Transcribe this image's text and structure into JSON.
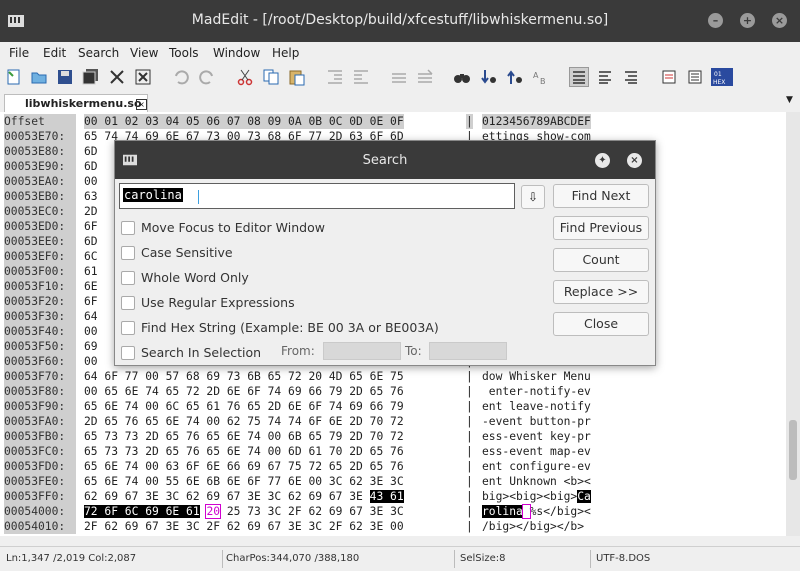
{
  "window": {
    "title": "MadEdit - [/root/Desktop/build/xfcestuff/libwhiskermenu.so]"
  },
  "menu": [
    "File",
    "Edit",
    "Search",
    "View",
    "Tools",
    "Window",
    "Help"
  ],
  "tab": {
    "label": "libwhiskermenu.so"
  },
  "hex": {
    "header": {
      "offset": "Offset",
      "hex": "00 01 02 03 04 05 06 07 08 09 0A 0B 0C 0D 0E 0F",
      "ascii": "0123456789ABCDEF"
    },
    "rows": [
      {
        "offset": "00053E70:",
        "hex": "65 74 74 69 6E 67 73 00 73 68 6F 77 2D 63 6F 6D",
        "ascii": "ettings show-com"
      },
      {
        "offset": "00053E80:",
        "hex": "6D",
        "ascii": ""
      },
      {
        "offset": "00053E90:",
        "hex": "6D",
        "ascii": ""
      },
      {
        "offset": "00053EA0:",
        "hex": "00",
        "ascii": ""
      },
      {
        "offset": "00053EB0:",
        "hex": "63",
        "ascii": ""
      },
      {
        "offset": "00053EC0:",
        "hex": "2D",
        "ascii": ""
      },
      {
        "offset": "00053ED0:",
        "hex": "6F",
        "ascii": ""
      },
      {
        "offset": "00053EE0:",
        "hex": "6D",
        "ascii": ""
      },
      {
        "offset": "00053EF0:",
        "hex": "6C",
        "ascii": ""
      },
      {
        "offset": "00053F00:",
        "hex": "61",
        "ascii": ""
      },
      {
        "offset": "00053F10:",
        "hex": "6E",
        "ascii": ""
      },
      {
        "offset": "00053F20:",
        "hex": "6F",
        "ascii": ""
      },
      {
        "offset": "00053F30:",
        "hex": "64",
        "ascii": ""
      },
      {
        "offset": "00053F40:",
        "hex": "00",
        "ascii": ""
      },
      {
        "offset": "00053F50:",
        "hex": "69",
        "ascii": ""
      },
      {
        "offset": "00053F60:",
        "hex": "00",
        "ascii": ""
      },
      {
        "offset": "00053F70:",
        "hex": "64 6F 77 00 57 68 69 73 6B 65 72 20 4D 65 6E 75",
        "ascii": "dow Whisker Menu"
      },
      {
        "offset": "00053F80:",
        "hex": "00 65 6E 74 65 72 2D 6E 6F 74 69 66 79 2D 65 76",
        "ascii": " enter-notify-ev"
      },
      {
        "offset": "00053F90:",
        "hex": "65 6E 74 00 6C 65 61 76 65 2D 6E 6F 74 69 66 79",
        "ascii": "ent leave-notify"
      },
      {
        "offset": "00053FA0:",
        "hex": "2D 65 76 65 6E 74 00 62 75 74 74 6F 6E 2D 70 72",
        "ascii": "-event button-pr"
      },
      {
        "offset": "00053FB0:",
        "hex": "65 73 73 2D 65 76 65 6E 74 00 6B 65 79 2D 70 72",
        "ascii": "ess-event key-pr"
      },
      {
        "offset": "00053FC0:",
        "hex": "65 73 73 2D 65 76 65 6E 74 00 6D 61 70 2D 65 76",
        "ascii": "ess-event map-ev"
      },
      {
        "offset": "00053FD0:",
        "hex": "65 6E 74 00 63 6F 6E 66 69 67 75 72 65 2D 65 76",
        "ascii": "ent configure-ev"
      },
      {
        "offset": "00053FE0:",
        "hex": "65 6E 74 00 55 6E 6B 6E 6F 77 6E 00 3C 62 3E 3C",
        "ascii": "ent Unknown <b><"
      },
      {
        "offset": "00053FF0:",
        "hex": "62 69 67 3E 3C 62 69 67 3E 3C 62 69 67 3E ",
        "hexsel": "43 61",
        "ascii": "big><big><big>",
        "asciisel": "Ca"
      },
      {
        "offset": "00054000:",
        "hexselpre": "72 6F 6C 69 6E 61",
        "hexcaret": "20",
        "hex": " 25 73 3C 2F 62 69 67 3E 3C",
        "asciiselpre": "rolina",
        "asciicaret": " ",
        "ascii": "%s</big><"
      },
      {
        "offset": "00054010:",
        "hex": "2F 62 69 67 3E 3C 2F 62 69 67 3E 3C 2F 62 3E 00",
        "ascii": "/big></big></b> "
      }
    ]
  },
  "status": {
    "pos": "Ln:1,347 /2,019 Col:2,087",
    "charpos": "CharPos:344,070 /388,180",
    "selsize": "SelSize:8",
    "encoding": "UTF-8.DOS"
  },
  "search_dialog": {
    "title": "Search",
    "query": "carolina",
    "options": [
      {
        "label": "Move Focus to Editor Window",
        "checked": false
      },
      {
        "label": "Case Sensitive",
        "checked": false
      },
      {
        "label": "Whole Word Only",
        "checked": false
      },
      {
        "label": "Use Regular Expressions",
        "checked": false
      },
      {
        "label": "Find Hex String (Example: BE 00 3A or BE003A)",
        "checked": false
      },
      {
        "label": "Search In Selection",
        "checked": false
      }
    ],
    "from_label": "From:",
    "to_label": "To:",
    "buttons": {
      "find_next": "Find Next",
      "find_previous": "Find Previous",
      "count": "Count",
      "replace": "Replace >>",
      "close": "Close"
    }
  },
  "toolbar_icons": [
    "new-file-icon",
    "open-file-icon",
    "save-icon",
    "save-all-icon",
    "close-icon",
    "close-all-icon",
    "undo-icon",
    "redo-icon",
    "cut-icon",
    "copy-icon",
    "paste-icon",
    "indent-icon",
    "unindent-icon",
    "comment-icon",
    "uncomment-icon",
    "find-icon",
    "find-next-icon",
    "find-previous-icon",
    "replace-icon",
    "text-mode-icon",
    "column-mode-icon",
    "hex-mode-icon",
    "wordwrap-icon",
    "options-icon",
    "hex-view-icon"
  ],
  "colors": {
    "titlebar": "#3a3a3a",
    "selection": "#000000",
    "caret": "#d000d0"
  }
}
